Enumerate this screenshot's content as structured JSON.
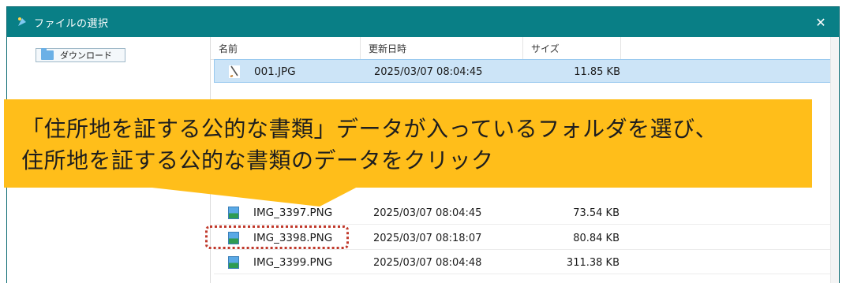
{
  "window": {
    "title": "ファイルの選択",
    "close_label": "✕"
  },
  "sidebar": {
    "folder_label": "ダウンロード"
  },
  "columns": {
    "name": "名前",
    "date": "更新日時",
    "size": "サイズ"
  },
  "files": [
    {
      "name": "001.JPG",
      "date": "2025/03/07 08:04:45",
      "size": "11.85 KB",
      "icon": "document-icon",
      "selected": true
    },
    {
      "name": "IMG_3397.PNG",
      "date": "2025/03/07 08:04:45",
      "size": "73.54 KB",
      "icon": "image-icon",
      "selected": false
    },
    {
      "name": "IMG_3398.PNG",
      "date": "2025/03/07 08:18:07",
      "size": "80.84 KB",
      "icon": "image-icon",
      "selected": false
    },
    {
      "name": "IMG_3399.PNG",
      "date": "2025/03/07 08:04:48",
      "size": "311.38 KB",
      "icon": "image-icon",
      "selected": false
    }
  ],
  "callout": {
    "line1": "「住所地を証する公的な書類」データが入っているフォルダを選び、",
    "line2": "住所地を証する公的な書類のデータをクリック"
  },
  "colors": {
    "titlebar": "#097f86",
    "callout": "#ffbe1a",
    "highlight": "#c0392b",
    "selected_row": "#cce4f7"
  }
}
